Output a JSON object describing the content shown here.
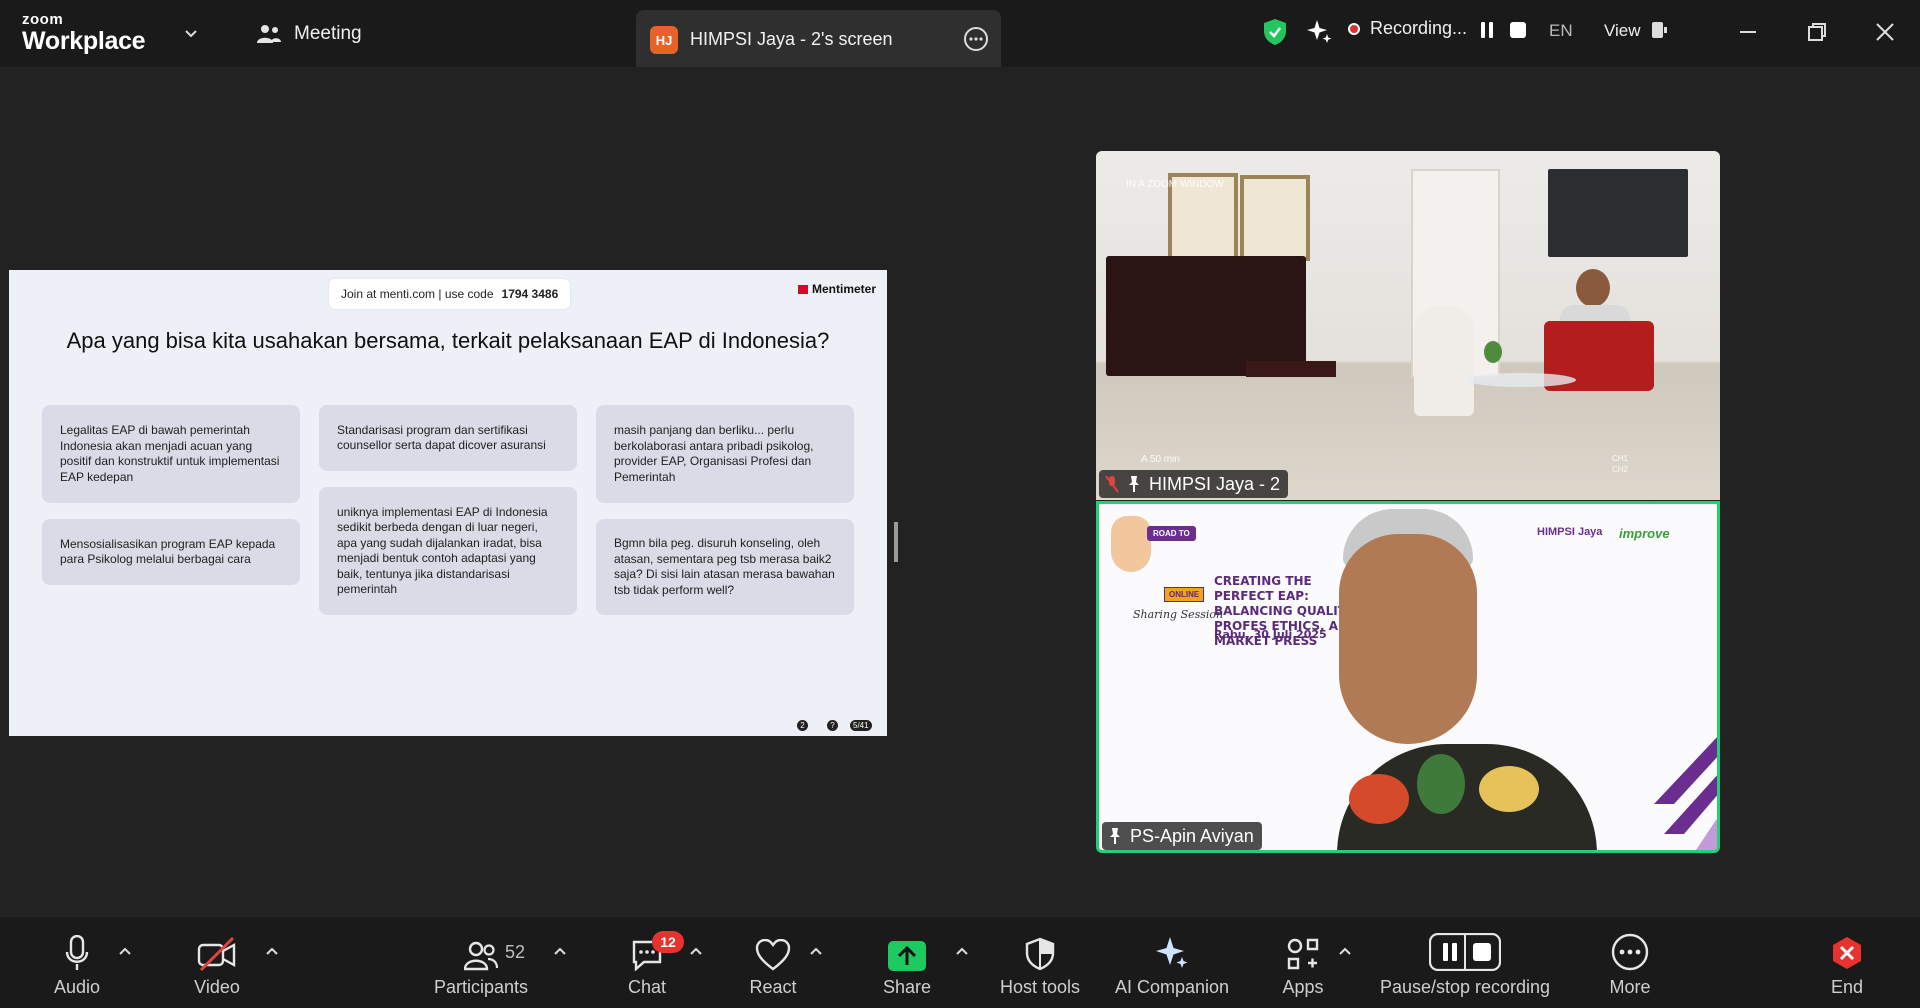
{
  "titlebar": {
    "logo_line1": "zoom",
    "logo_line2": "Workplace",
    "meeting_label": "Meeting",
    "tab_initials": "HJ",
    "tab_title": "HIMPSI Jaya - 2's screen",
    "recording_label": "Recording...",
    "language": "EN",
    "view_label": "View"
  },
  "slide": {
    "join_text": "Join at menti.com | use code",
    "join_code": "1794 3486",
    "brand": "Mentimeter",
    "question": "Apa yang bisa kita usahakan bersama, terkait pelaksanaan EAP di Indonesia?",
    "cards": [
      "Legalitas EAP di bawah pemerintah Indonesia akan menjadi acuan yang positif dan konstruktif untuk implementasi EAP kedepan",
      "Standarisasi program dan sertifikasi counsellor serta dapat dicover asuransi",
      "masih panjang dan berliku... perlu berkolaborasi antara pribadi psikolog, provider EAP, Organisasi Profesi dan Pemerintah",
      "Mensosialisasikan program EAP kepada para Psikolog melalui berbagai cara",
      "uniknya implementasi EAP di Indonesia sedikit berbeda dengan di luar negeri, apa yang sudah dijalankan iradat, bisa menjadi bentuk contoh adaptasi yang baik, tentunya jika distandarisasi pemerintah",
      "Bgmn bila peg. disuruh konseling, oleh atasan, sementara peg tsb merasa baik2 saja? Di sisi lain atasan merasa bawahan tsb tidak perform well?"
    ],
    "footer_icon1": "2",
    "footer_icon2": "?",
    "pager": "5/41"
  },
  "videos": [
    {
      "name": "HIMPSI Jaya - 2",
      "overlay_top": "IN A ZOOM WINDOW",
      "overlay_bottom": "A  50 min",
      "ch1": "CH1",
      "ch2": "CH2"
    },
    {
      "name": "PS-Apin Aviyan",
      "banner": {
        "road_to": "ROAD TO",
        "online": "ONLINE",
        "sharing": "Sharing Session",
        "title": "CREATING THE PERFECT EAP: BALANCING QUALITY, PROFES ETHICS, AND MARKET PRESS",
        "date": "Rabu, 30 Juli 2025",
        "logo1": "HIMPSI Jaya",
        "logo2": "improve"
      }
    }
  ],
  "toolbar": {
    "audio": "Audio",
    "video": "Video",
    "participants": "Participants",
    "participants_count": "52",
    "chat": "Chat",
    "chat_badge": "12",
    "react": "React",
    "share": "Share",
    "host_tools": "Host tools",
    "ai_companion": "AI Companion",
    "apps": "Apps",
    "pause_stop": "Pause/stop recording",
    "more": "More",
    "end": "End"
  },
  "colors": {
    "accent_green": "#22d07a",
    "record_red": "#e02f2f",
    "share_green": "#1ec95f",
    "end_red": "#e8322f"
  },
  "icons": [
    "chevron-down-icon",
    "people-icon",
    "more-icon",
    "shield-check-icon",
    "sparkle-icon",
    "pause-icon",
    "stop-icon",
    "view-icon",
    "minimize-icon",
    "restore-icon",
    "close-icon",
    "microphone-icon",
    "video-off-icon",
    "participants-icon",
    "chat-icon",
    "heart-icon",
    "share-arrow-icon",
    "host-shield-icon",
    "ai-sparkle-icon",
    "apps-icon",
    "pause-stop-icon",
    "ellipsis-icon",
    "end-icon",
    "mic-muted-icon",
    "pin-icon"
  ]
}
